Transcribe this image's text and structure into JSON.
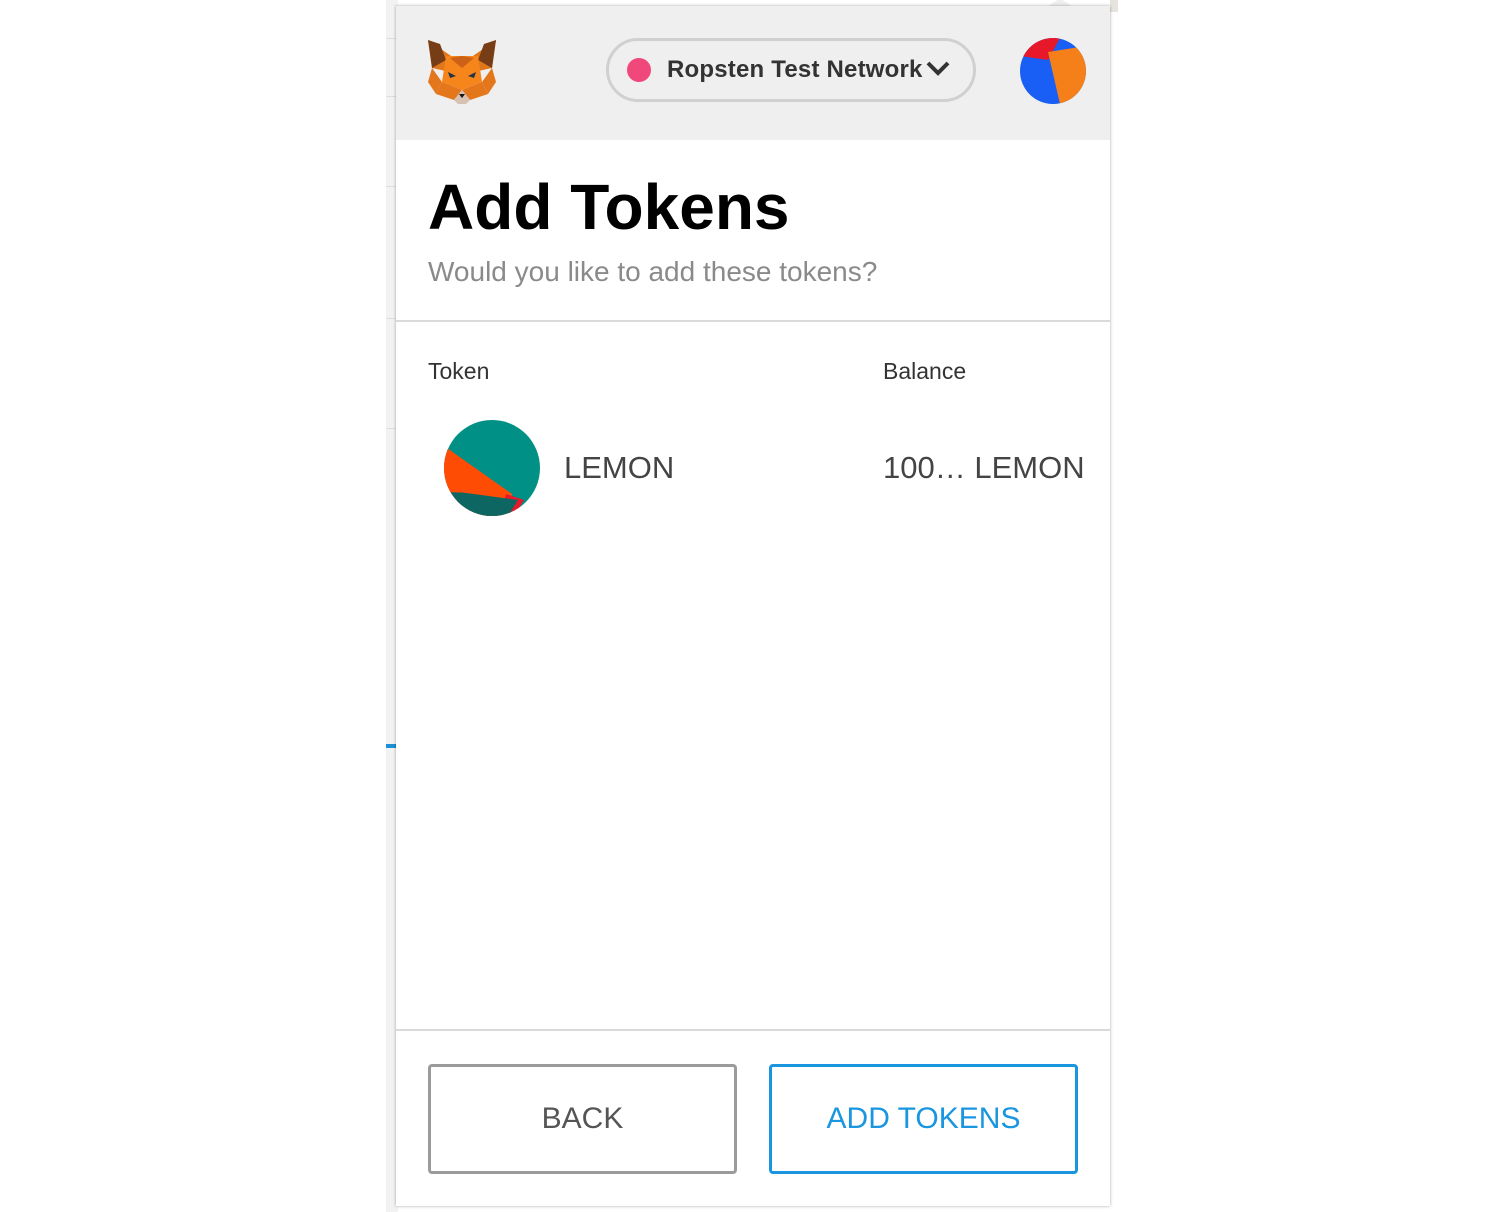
{
  "header": {
    "network": {
      "label": "Ropsten Test Network",
      "dot_color": "#f0487a"
    },
    "logo_icon": "metamask-fox-icon",
    "avatar_icon": "account-identicon"
  },
  "page": {
    "title": "Add Tokens",
    "subtitle": "Would you like to add these tokens?"
  },
  "table": {
    "columns": [
      "Token",
      "Balance"
    ],
    "rows": [
      {
        "name": "LEMON",
        "balance": "100… LEMON",
        "icon": "token-identicon"
      }
    ]
  },
  "buttons": {
    "back_label": "BACK",
    "add_label": "ADD TOKENS"
  },
  "colors": {
    "accent": "#1a95e0",
    "header_bg": "#efefef"
  }
}
